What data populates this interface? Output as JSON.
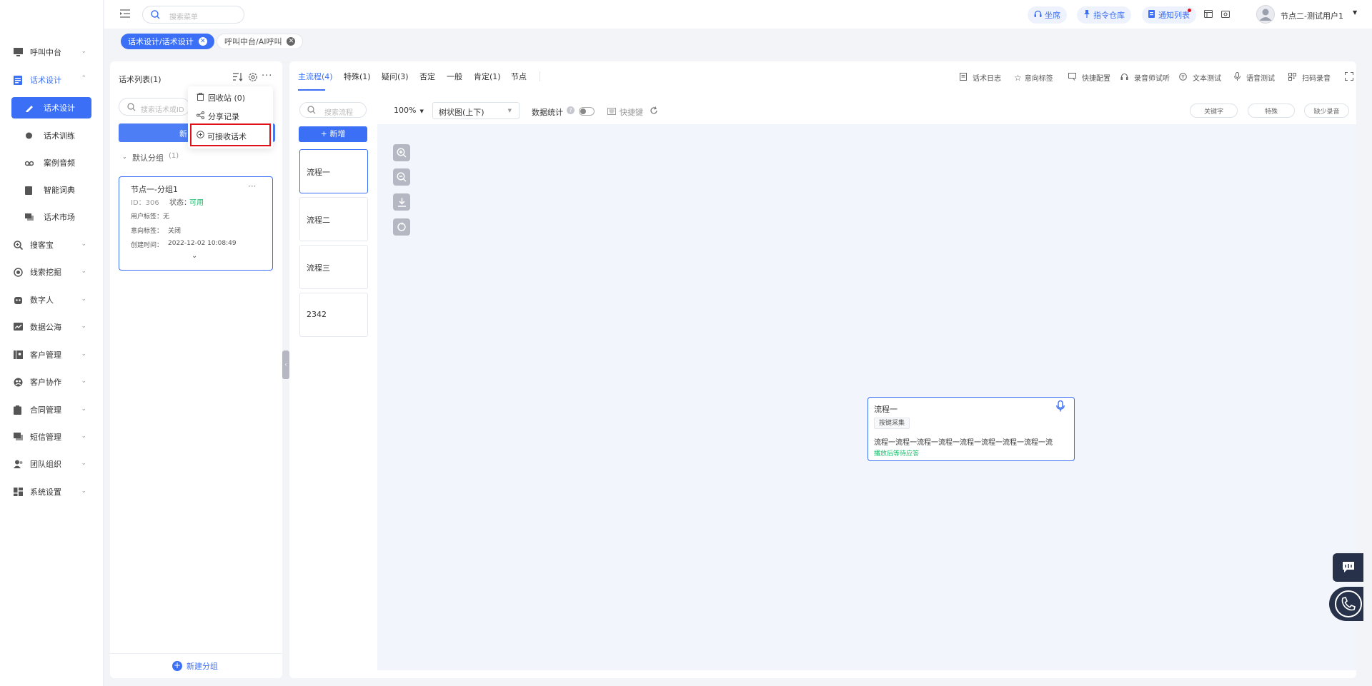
{
  "search_menu": {
    "placeholder": "搜索菜单"
  },
  "top_buttons": {
    "agent": "坐席",
    "command": "指令仓库",
    "notify": "通知列表"
  },
  "user": {
    "name": "节点二-测试用户1"
  },
  "open_tabs": [
    {
      "label": "话术设计/话术设计"
    },
    {
      "label": "呼叫中台/AI呼叫"
    }
  ],
  "sidebar": {
    "items": [
      {
        "label": "呼叫中台"
      },
      {
        "label": "话术设计"
      },
      {
        "label": "话术设计"
      },
      {
        "label": "话术训练"
      },
      {
        "label": "案例音频"
      },
      {
        "label": "智能词典"
      },
      {
        "label": "话术市场"
      },
      {
        "label": "搜客宝"
      },
      {
        "label": "线索挖掘"
      },
      {
        "label": "数字人"
      },
      {
        "label": "数据公海"
      },
      {
        "label": "客户管理"
      },
      {
        "label": "客户协作"
      },
      {
        "label": "合同管理"
      },
      {
        "label": "短信管理"
      },
      {
        "label": "团队组织"
      },
      {
        "label": "系统设置"
      }
    ]
  },
  "script_list": {
    "title": "话术列表(1)",
    "search_placeholder": "搜索话术或ID",
    "new_button": "新",
    "group": {
      "name": "默认分组",
      "count": "(1)"
    },
    "card": {
      "title": "节点一-分组1",
      "id": "ID：306",
      "status_label": "状态：",
      "status_value": "可用",
      "user_tag": "用户标签：无",
      "intent_tag_label": "意向标签：",
      "intent_tag_value": "关闭",
      "created_label": "创建时间：",
      "created_value": "2022-12-02 10:08:49"
    },
    "new_group": "新建分组"
  },
  "dropdown": {
    "items": [
      {
        "label": "回收站 (0)"
      },
      {
        "label": "分享记录"
      },
      {
        "label": "可接收话术"
      }
    ]
  },
  "flow_tabs": [
    {
      "label": "主流程(4)"
    },
    {
      "label": "特殊(1)"
    },
    {
      "label": "疑问(3)"
    },
    {
      "label": "否定"
    },
    {
      "label": "一般"
    },
    {
      "label": "肯定(1)"
    },
    {
      "label": "节点"
    }
  ],
  "right_tools": [
    "话术日志",
    "意向标签",
    "快捷配置",
    "录音师试听",
    "文本测试",
    "语音测试",
    "扫码录音"
  ],
  "flow_search": {
    "placeholder": "搜索流程"
  },
  "add_flow": "+ 新增",
  "flows": [
    {
      "label": "流程一"
    },
    {
      "label": "流程二"
    },
    {
      "label": "流程三"
    },
    {
      "label": "2342"
    }
  ],
  "canvas_toolbar": {
    "zoom": "100%",
    "layout": "树状图(上下)",
    "stats_label": "数据统计",
    "shortcut": "快捷键",
    "keyword": "关键字",
    "special": "特殊",
    "short_record": "缺少录音"
  },
  "node": {
    "title": "流程一",
    "tag": "按键采集",
    "content": "流程一流程一流程一流程一流程一流程一流程一流程一流",
    "status": "播放后等待应答"
  },
  "colors": {
    "primary": "#3b6ff5",
    "success": "#19be6b",
    "highlight": "#e0101a",
    "canvas": "#f2f5fb"
  }
}
